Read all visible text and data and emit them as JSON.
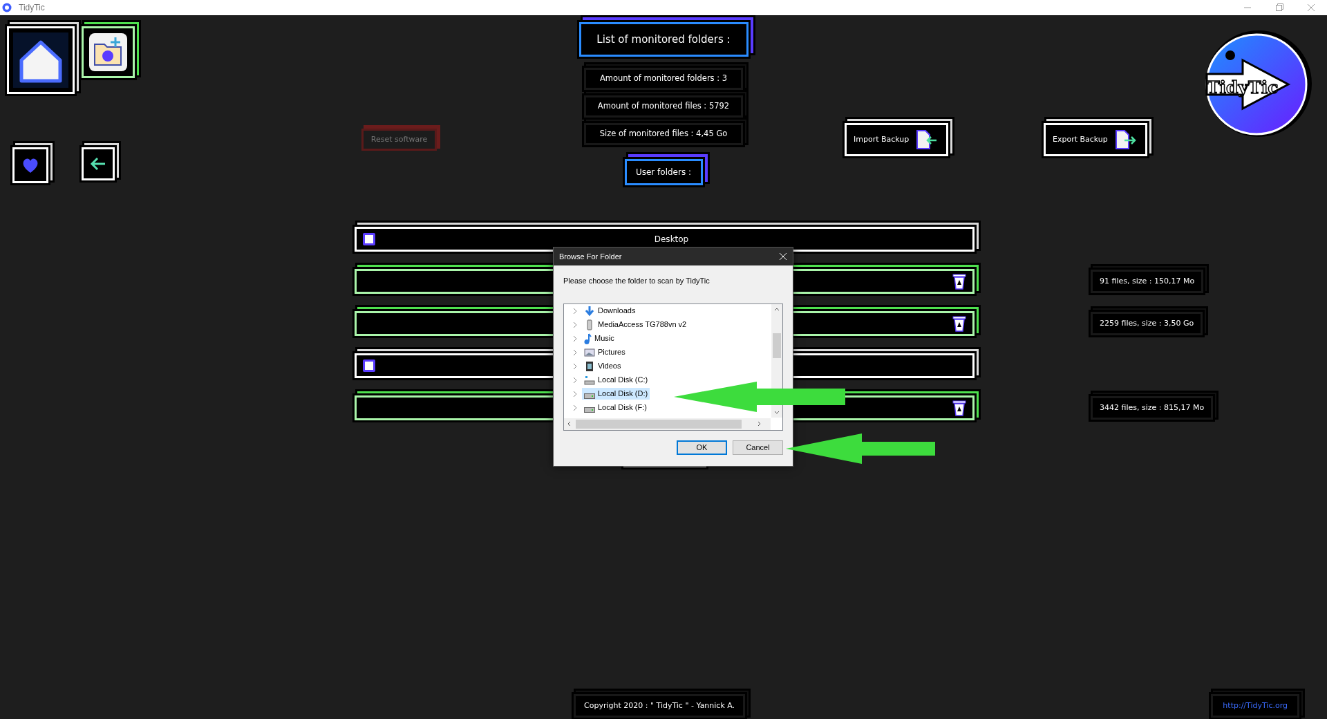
{
  "window": {
    "title": "TidyTic"
  },
  "nav_buttons": [
    {
      "kind": "home"
    },
    {
      "kind": "add-folder"
    },
    {
      "kind": "heart"
    },
    {
      "kind": "back"
    }
  ],
  "reset_button": {
    "label": "Reset software",
    "disabled": true
  },
  "header": "List of monitored folders :",
  "stats": [
    "Amount of monitored folders : 3",
    "Amount of monitored files : 5792",
    "Size of monitored files : 4,45 Go"
  ],
  "backup_buttons": [
    {
      "label": "Import Backup",
      "kind": "import"
    },
    {
      "label": "Export Backup",
      "kind": "export"
    }
  ],
  "logo": {
    "text": "TidyTic"
  },
  "section_title": "User folders :",
  "folders": [
    {
      "label": "Desktop",
      "monitored": false
    },
    {
      "monitored": true,
      "summary": "91 files, size : 150,17 Mo"
    },
    {
      "monitored": true,
      "summary": "2259 files, size : 3,50 Go"
    },
    {
      "monitored": false
    },
    {
      "monitored": true,
      "summary": "3442 files, size : 815,17 Mo"
    }
  ],
  "dialog": {
    "title": "Browse For Folder",
    "prompt": "Please choose the folder to scan by TidyTic",
    "tree": [
      {
        "label": "Downloads",
        "kind": "downloads",
        "selected": false
      },
      {
        "label": "MediaAccess TG788vn v2",
        "kind": "device",
        "selected": false
      },
      {
        "label": "Music",
        "kind": "music",
        "selected": false
      },
      {
        "label": "Pictures",
        "kind": "pictures",
        "selected": false
      },
      {
        "label": "Videos",
        "kind": "videos",
        "selected": false
      },
      {
        "label": "Local Disk (C:)",
        "kind": "system-disk",
        "selected": false
      },
      {
        "label": "Local Disk (D:)",
        "kind": "disk",
        "selected": true
      },
      {
        "label": "Local Disk (F:)",
        "kind": "disk",
        "selected": false
      }
    ],
    "buttons": [
      {
        "label": "OK",
        "default": true
      },
      {
        "label": "Cancel",
        "default": false
      }
    ]
  },
  "footer": {
    "copyright": "Copyright 2020 : \" TidyTic \" - Yannick A.",
    "link": "http://TidyTic.org"
  }
}
